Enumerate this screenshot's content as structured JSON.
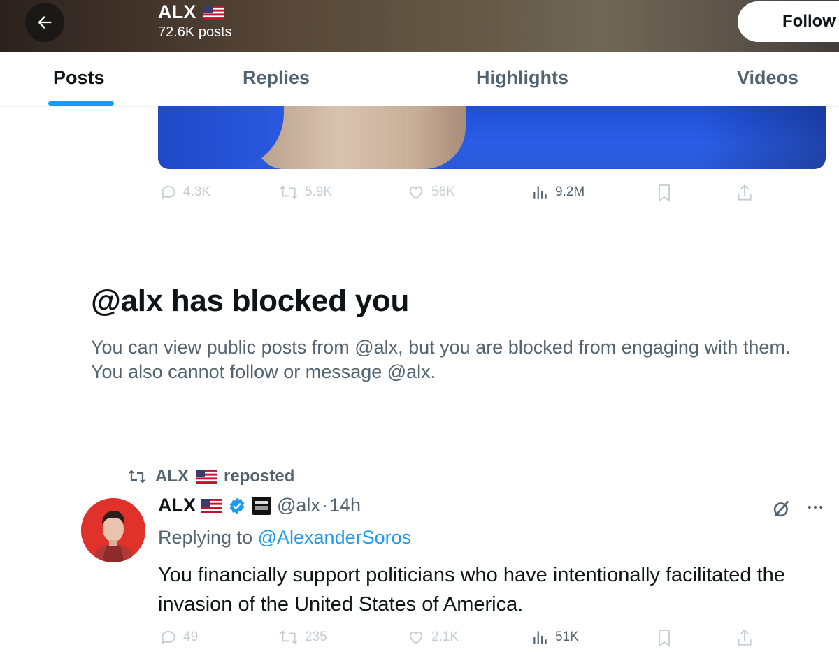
{
  "header": {
    "title": "ALX",
    "subtitle": "72.6K posts",
    "follow_label": "Follow"
  },
  "tabs": [
    {
      "label": "Posts",
      "active": true
    },
    {
      "label": "Replies",
      "active": false
    },
    {
      "label": "Highlights",
      "active": false
    },
    {
      "label": "Videos",
      "active": false
    }
  ],
  "post1_actions": {
    "replies": "4.3K",
    "reposts": "5.9K",
    "likes": "56K",
    "views": "9.2M"
  },
  "blocked": {
    "title": "@alx has blocked you",
    "body": "You can view public posts from @alx, but you are blocked from engaging with them. You also cannot follow or message @alx."
  },
  "post2": {
    "repost_by": "ALX",
    "repost_suffix": "reposted",
    "author": "ALX",
    "handle": "@alx",
    "time": "14h",
    "replying_prefix": "Replying to",
    "replying_to": "@AlexanderSoros",
    "text": "You financially support politicians who have intentionally facilitated the invasion of the United States of America.",
    "actions": {
      "replies": "49",
      "reposts": "235",
      "likes": "2.1K",
      "views": "51K"
    }
  },
  "colors": {
    "accent": "#1d9bf0",
    "text": "#0f1419",
    "muted": "#536471"
  },
  "icons": [
    "back-arrow-icon",
    "us-flag-icon",
    "reply-icon",
    "repost-icon",
    "like-icon",
    "views-icon",
    "bookmark-icon",
    "share-icon",
    "verified-badge-icon",
    "grok-icon",
    "more-icon"
  ]
}
